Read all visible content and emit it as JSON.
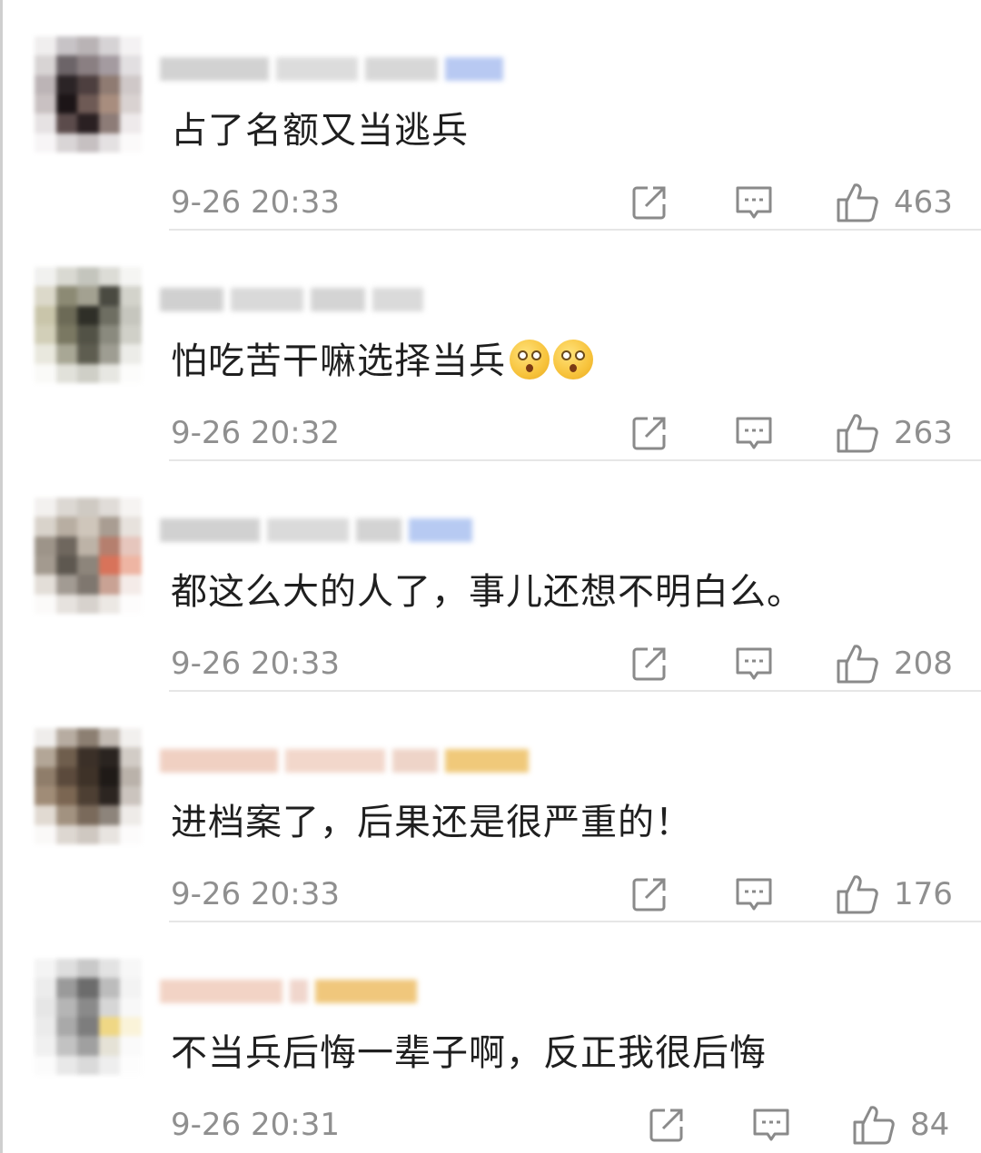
{
  "comments": [
    {
      "text": "占了名额又当逃兵",
      "time": "9-26 20:33",
      "likes": "463",
      "emojis": 0
    },
    {
      "text": "怕吃苦干嘛选择当兵",
      "time": "9-26 20:32",
      "likes": "263",
      "emojis": 2
    },
    {
      "text": "都这么大的人了，事儿还想不明白么。",
      "time": "9-26 20:33",
      "likes": "208",
      "emojis": 0
    },
    {
      "text": "进档案了，后果还是很严重的！",
      "time": "9-26 20:33",
      "likes": "176",
      "emojis": 0
    },
    {
      "text": "不当兵后悔一辈子啊，反正我很后悔",
      "time": "9-26 20:31",
      "likes": "84",
      "emojis": 0
    }
  ],
  "icons": {
    "share": "share-icon",
    "reply": "comment-icon",
    "like": "thumbs-up-icon"
  },
  "colors": {
    "meta_text": "#8f8f8f",
    "divider": "#e6e6e6",
    "content_text": "#1f1f1f",
    "icon_stroke": "#8a8a8a"
  }
}
